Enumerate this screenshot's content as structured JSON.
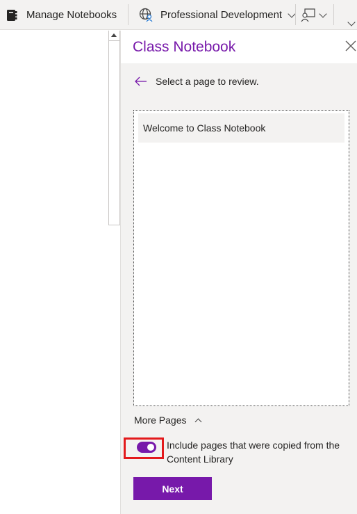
{
  "ribbon": {
    "manage_notebooks_label": "Manage Notebooks",
    "professional_development_label": "Professional Development"
  },
  "pane": {
    "title": "Class Notebook",
    "back_text": "Select a page to review.",
    "pages": [
      {
        "label": "Welcome to Class Notebook"
      }
    ],
    "more_pages_label": "More Pages",
    "toggle_on": true,
    "toggle_label": "Include pages that were copied from the Content Library",
    "next_label": "Next",
    "accent_color": "#7719aa",
    "highlight_color": "#e31a1c"
  }
}
